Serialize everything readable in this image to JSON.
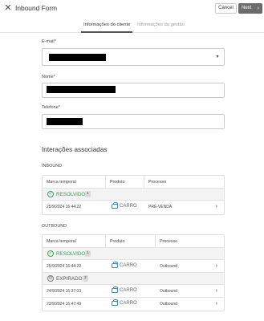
{
  "header": {
    "close_glyph": "✕",
    "title": "Inbound Form",
    "cancel_label": "Cancel",
    "next_label": "Next",
    "next_chevron": "›"
  },
  "tabs": [
    {
      "label": "Informações do cliente",
      "active": true
    },
    {
      "label": "Informações da gestão",
      "active": false
    }
  ],
  "form": {
    "email_label": "E-mail*",
    "email_caret": "▼",
    "name_label": "Nome*",
    "phone_label": "Telefone*"
  },
  "interactions": {
    "title": "Interações associadas",
    "inbound": {
      "group_label": "INBOUND",
      "headers": [
        "Marca temporal",
        "Produto",
        "Processo"
      ],
      "groups": [
        {
          "status": "RESOLVIDO",
          "status_glyph": "✓",
          "count": "1",
          "rows": [
            {
              "timestamp": "25/9/2024 16:44:22",
              "product": "CARRO",
              "process": "PRÉ-VENDA"
            }
          ]
        }
      ]
    },
    "outbound": {
      "group_label": "OUTBOUND",
      "headers": [
        "Marca temporal",
        "Produto",
        "Processo"
      ],
      "groups": [
        {
          "status": "RESOLVIDO",
          "status_glyph": "✓",
          "count": "1",
          "rows": [
            {
              "timestamp": "25/9/2024 16:44:22",
              "product": "CARRO",
              "process": "Outbound"
            }
          ]
        },
        {
          "status": "EXPIRADO",
          "status_glyph": "⊘",
          "count": "2",
          "rows": [
            {
              "timestamp": "24/9/2024 16:37:03",
              "product": "CARRO",
              "process": "Outbound"
            },
            {
              "timestamp": "23/9/2024 16:47:49",
              "product": "CARRO",
              "process": "Outbound"
            }
          ]
        }
      ]
    }
  },
  "row_chevron": "›",
  "colors": {
    "resolved": "#2f9b57",
    "expired": "#555555",
    "next_button": "#6b6b6b",
    "car_icon": "#3a8fb0"
  }
}
